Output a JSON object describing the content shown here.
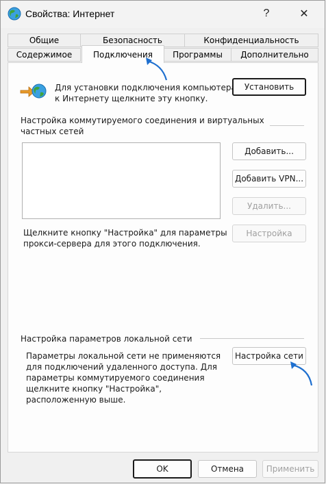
{
  "window": {
    "title": "Свойства: Интернет",
    "help_glyph": "?",
    "close_glyph": "✕"
  },
  "tabs": {
    "row1": [
      "Общие",
      "Безопасность",
      "Конфиденциальность"
    ],
    "row2": [
      "Содержимое",
      "Подключения",
      "Программы",
      "Дополнительно"
    ],
    "active": "Подключения"
  },
  "setup": {
    "text": "Для установки подключения компьютера к Интернету щелкните эту кнопку.",
    "line1": "Для установки подключения компьютера",
    "line2": "к Интернету щелкните эту кнопку.",
    "button": "Установить"
  },
  "dialup": {
    "heading1": "Настройка коммутируемого соединения и виртуальных",
    "heading2": "частных сетей",
    "add_button": "Добавить...",
    "add_vpn_button": "Добавить VPN...",
    "remove_button": "Удалить...",
    "settings_button": "Настройка",
    "hint1": "Щелкните кнопку \"Настройка\" для параметры",
    "hint2": "прокси-сервера для этого подключения."
  },
  "lan": {
    "heading": "Настройка параметров локальной сети",
    "desc1": "Параметры локальной сети не применяются",
    "desc2": "для подключений удаленного доступа. Для",
    "desc3": "параметры коммутируемого соединения",
    "desc4": "щелкните кнопку \"Настройка\",",
    "desc5": "расположенную выше.",
    "button": "Настройка сети"
  },
  "footer": {
    "ok": "OK",
    "cancel": "Отмена",
    "apply": "Применить"
  },
  "colors": {
    "accent_arrow": "#1e6fcf"
  }
}
